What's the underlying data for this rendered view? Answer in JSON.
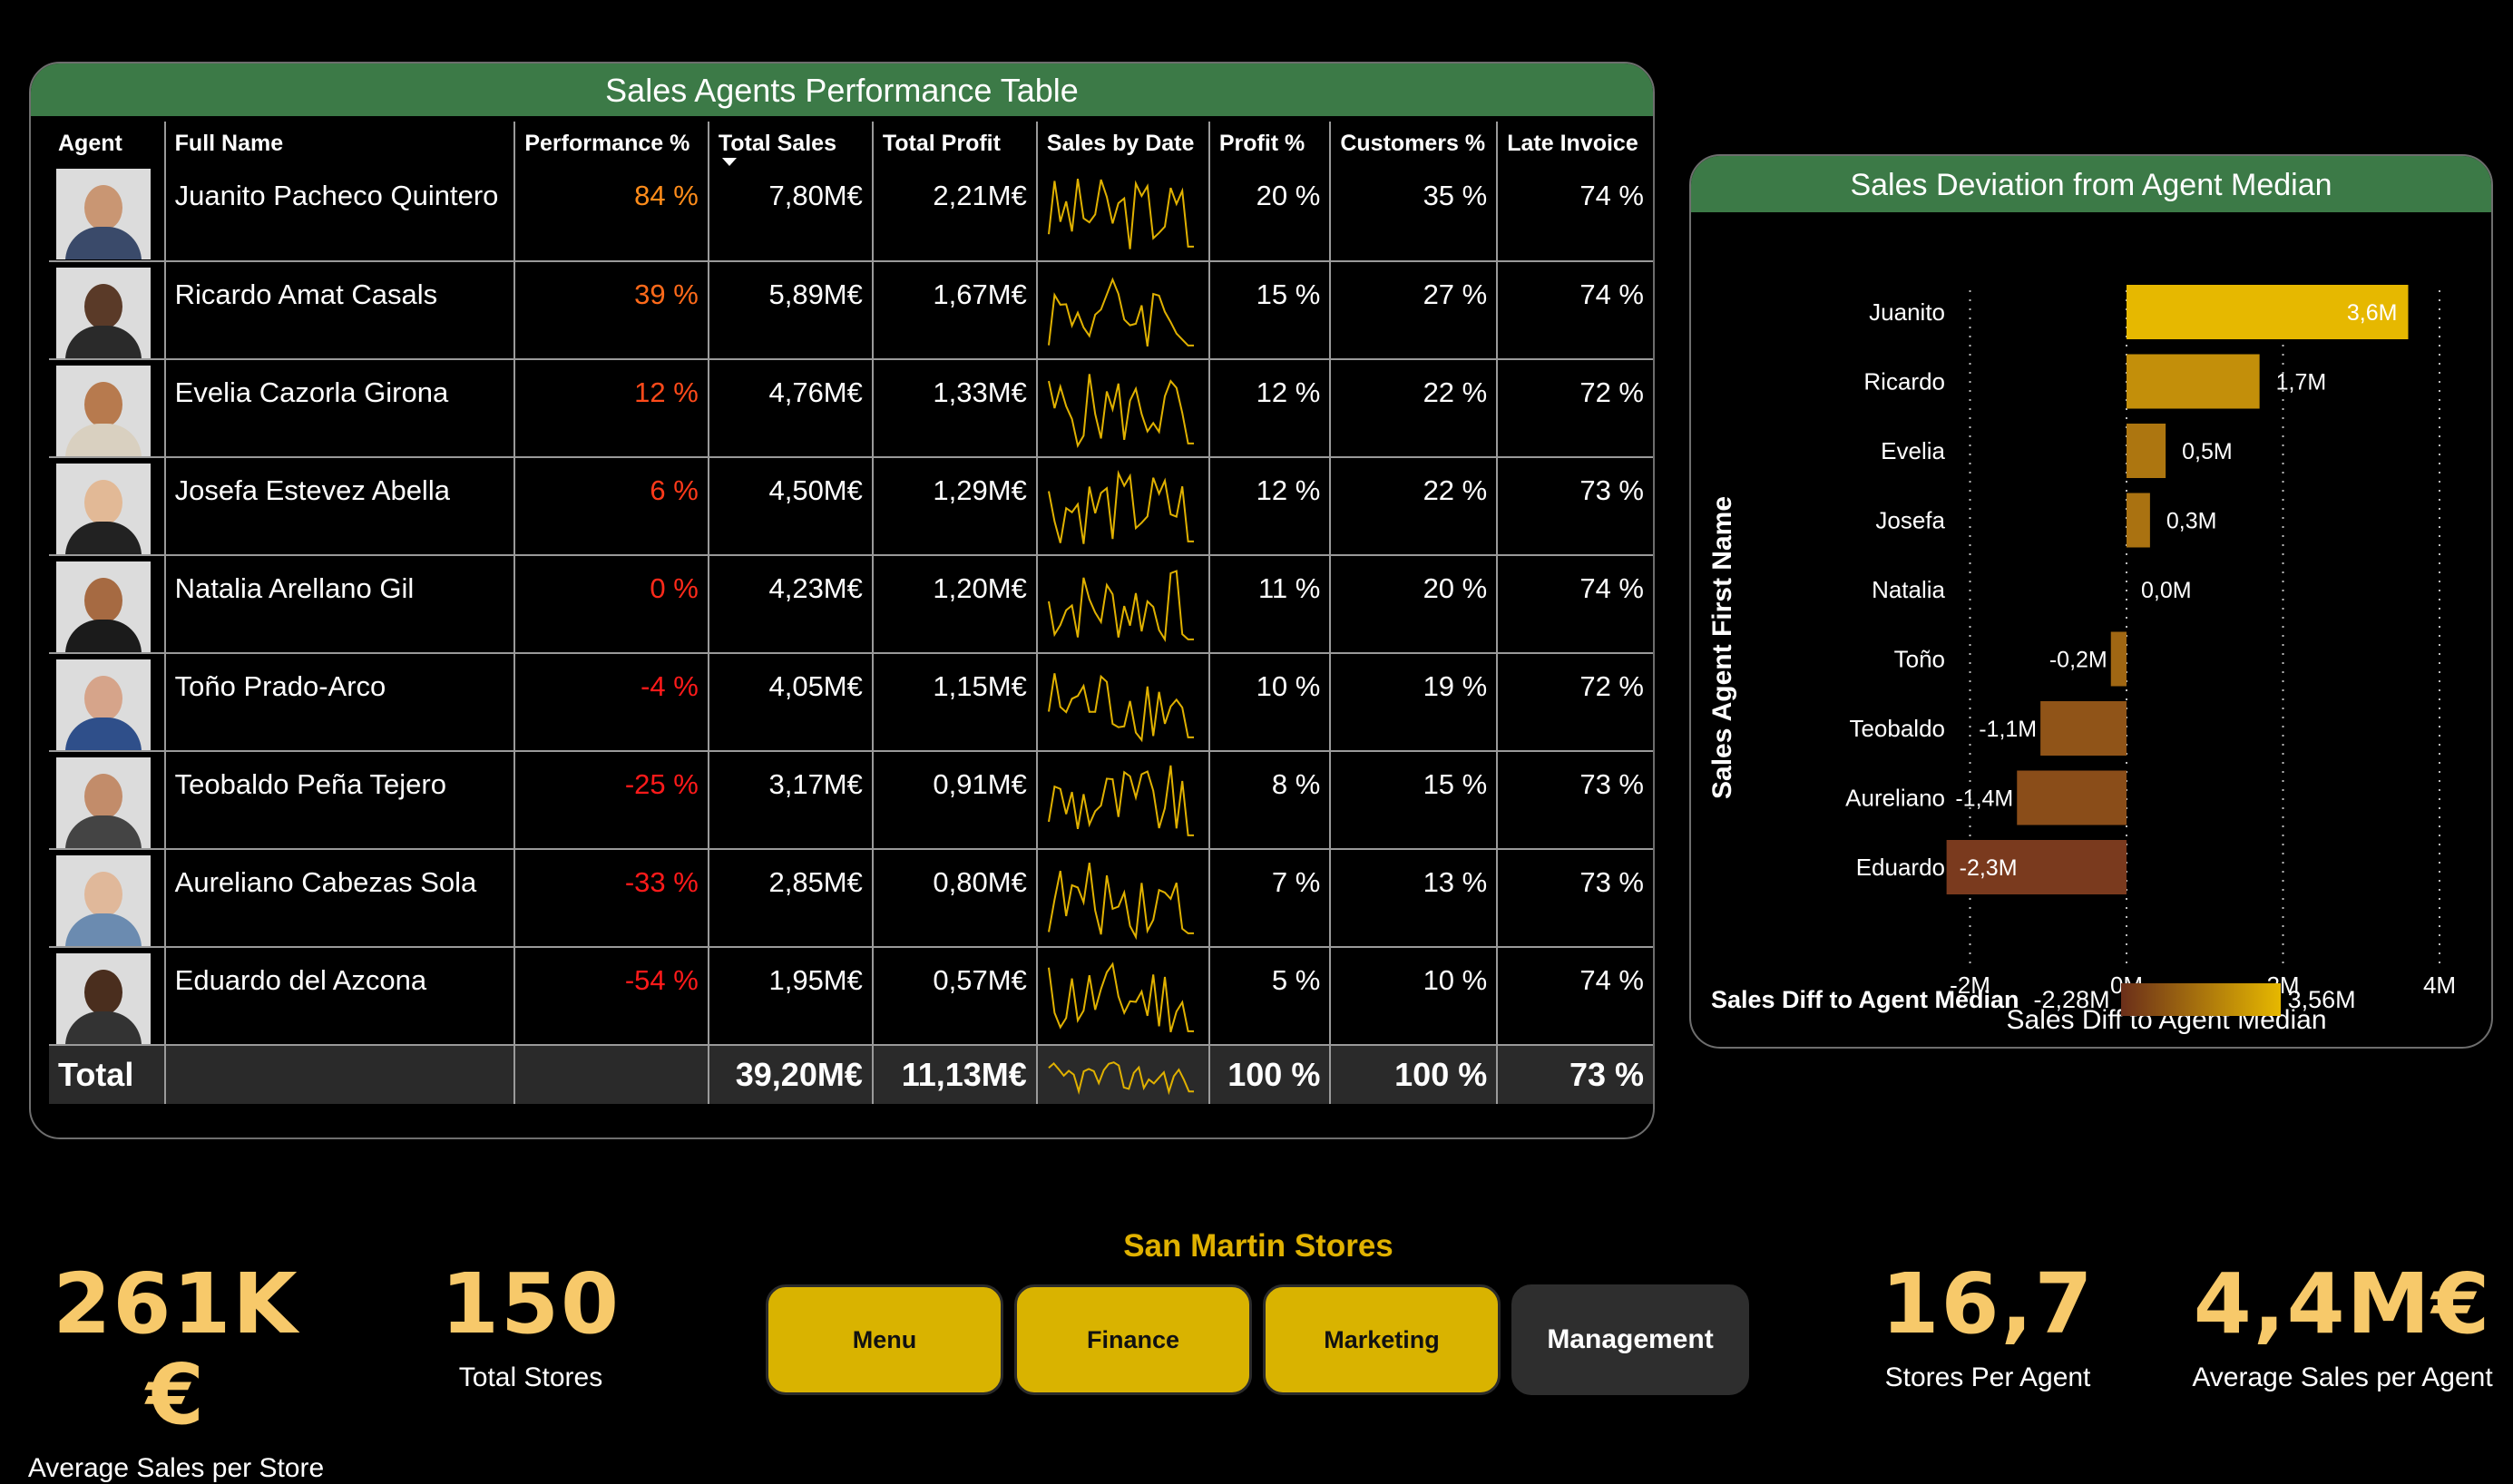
{
  "table": {
    "title": "Sales Agents Performance Table",
    "columns": [
      "Agent",
      "Full Name",
      "Performance %",
      "Total Sales",
      "Total Profit",
      "Sales by Date",
      "Profit %",
      "Customers %",
      "Late Invoice"
    ],
    "rows": [
      {
        "full_name": "Juanito Pacheco Quintero",
        "performance": "84 %",
        "perf_color": "#ff8c1a",
        "sales": "7,80M€",
        "profit": "2,21M€",
        "profit_pct": "20 %",
        "customers": "35 %",
        "late": "74 %"
      },
      {
        "full_name": "Ricardo Amat Casals",
        "performance": "39 %",
        "perf_color": "#ff6a1a",
        "sales": "5,89M€",
        "profit": "1,67M€",
        "profit_pct": "15 %",
        "customers": "27 %",
        "late": "74 %"
      },
      {
        "full_name": "Evelia Cazorla Girona",
        "performance": "12 %",
        "perf_color": "#ff4a1a",
        "sales": "4,76M€",
        "profit": "1,33M€",
        "profit_pct": "12 %",
        "customers": "22 %",
        "late": "72 %"
      },
      {
        "full_name": "Josefa Estevez Abella",
        "performance": "6 %",
        "perf_color": "#ff3a1a",
        "sales": "4,50M€",
        "profit": "1,29M€",
        "profit_pct": "12 %",
        "customers": "22 %",
        "late": "73 %"
      },
      {
        "full_name": "Natalia Arellano Gil",
        "performance": "0 %",
        "perf_color": "#ff2a1a",
        "sales": "4,23M€",
        "profit": "1,20M€",
        "profit_pct": "11 %",
        "customers": "20 %",
        "late": "74 %"
      },
      {
        "full_name": "Toño Prado-Arco",
        "performance": "-4 %",
        "perf_color": "#ff1a1a",
        "sales": "4,05M€",
        "profit": "1,15M€",
        "profit_pct": "10 %",
        "customers": "19 %",
        "late": "72 %"
      },
      {
        "full_name": "Teobaldo Peña Tejero",
        "performance": "-25 %",
        "perf_color": "#ff1a1a",
        "sales": "3,17M€",
        "profit": "0,91M€",
        "profit_pct": "8 %",
        "customers": "15 %",
        "late": "73 %"
      },
      {
        "full_name": "Aureliano Cabezas Sola",
        "performance": "-33 %",
        "perf_color": "#ff1a1a",
        "sales": "2,85M€",
        "profit": "0,80M€",
        "profit_pct": "7 %",
        "customers": "13 %",
        "late": "73 %"
      },
      {
        "full_name": "Eduardo del Azcona",
        "performance": "-54 %",
        "perf_color": "#ff1a1a",
        "sales": "1,95M€",
        "profit": "0,57M€",
        "profit_pct": "5 %",
        "customers": "10 %",
        "late": "74 %"
      }
    ],
    "total": {
      "label": "Total",
      "sales": "39,20M€",
      "profit": "11,13M€",
      "profit_pct": "100 %",
      "customers": "100 %",
      "late": "73 %"
    },
    "sparkline_color": "#e0b100"
  },
  "deviation_chart": {
    "title": "Sales Deviation from Agent Median",
    "legend_title": "Sales Diff to Agent Median",
    "legend_min": "-2,28M",
    "legend_max": "3,56M",
    "colors": {
      "positive": "#e6b800",
      "negative": "#7a3a1e"
    }
  },
  "chart_data": {
    "type": "bar",
    "orientation": "horizontal",
    "title": "Sales Deviation from Agent Median",
    "xlabel": "Sales Diff to Agent Median",
    "ylabel": "Sales Agent First Name",
    "categories": [
      "Juanito",
      "Ricardo",
      "Evelia",
      "Josefa",
      "Natalia",
      "Toño",
      "Teobaldo",
      "Aureliano",
      "Eduardo"
    ],
    "values": [
      3.6,
      1.7,
      0.5,
      0.3,
      0.0,
      -0.2,
      -1.1,
      -1.4,
      -2.3
    ],
    "data_labels": [
      "3,6M",
      "1,7M",
      "0,5M",
      "0,3M",
      "0,0M",
      "-0,2M",
      "-1,1M",
      "-1,4M",
      "-2,3M"
    ],
    "xticks": [
      -2,
      0,
      2,
      4
    ],
    "xtick_labels": [
      "-2M",
      "0M",
      "2M",
      "4M"
    ],
    "xlim": [
      -2.3,
      4.2
    ],
    "grid": "vertical dotted"
  },
  "kpis": {
    "avg_sales_store": {
      "value": "261K €",
      "label": "Average Sales per Store"
    },
    "total_stores": {
      "value": "150",
      "label": "Total Stores"
    },
    "stores_per_agent": {
      "value": "16,7",
      "label": "Stores Per Agent"
    },
    "avg_sales_agent": {
      "value": "4,4M€",
      "label": "Average Sales per Agent"
    }
  },
  "nav": {
    "title": "San Martin Stores",
    "buttons": [
      "Menu",
      "Finance",
      "Marketing",
      "Management"
    ],
    "active": "Management"
  }
}
